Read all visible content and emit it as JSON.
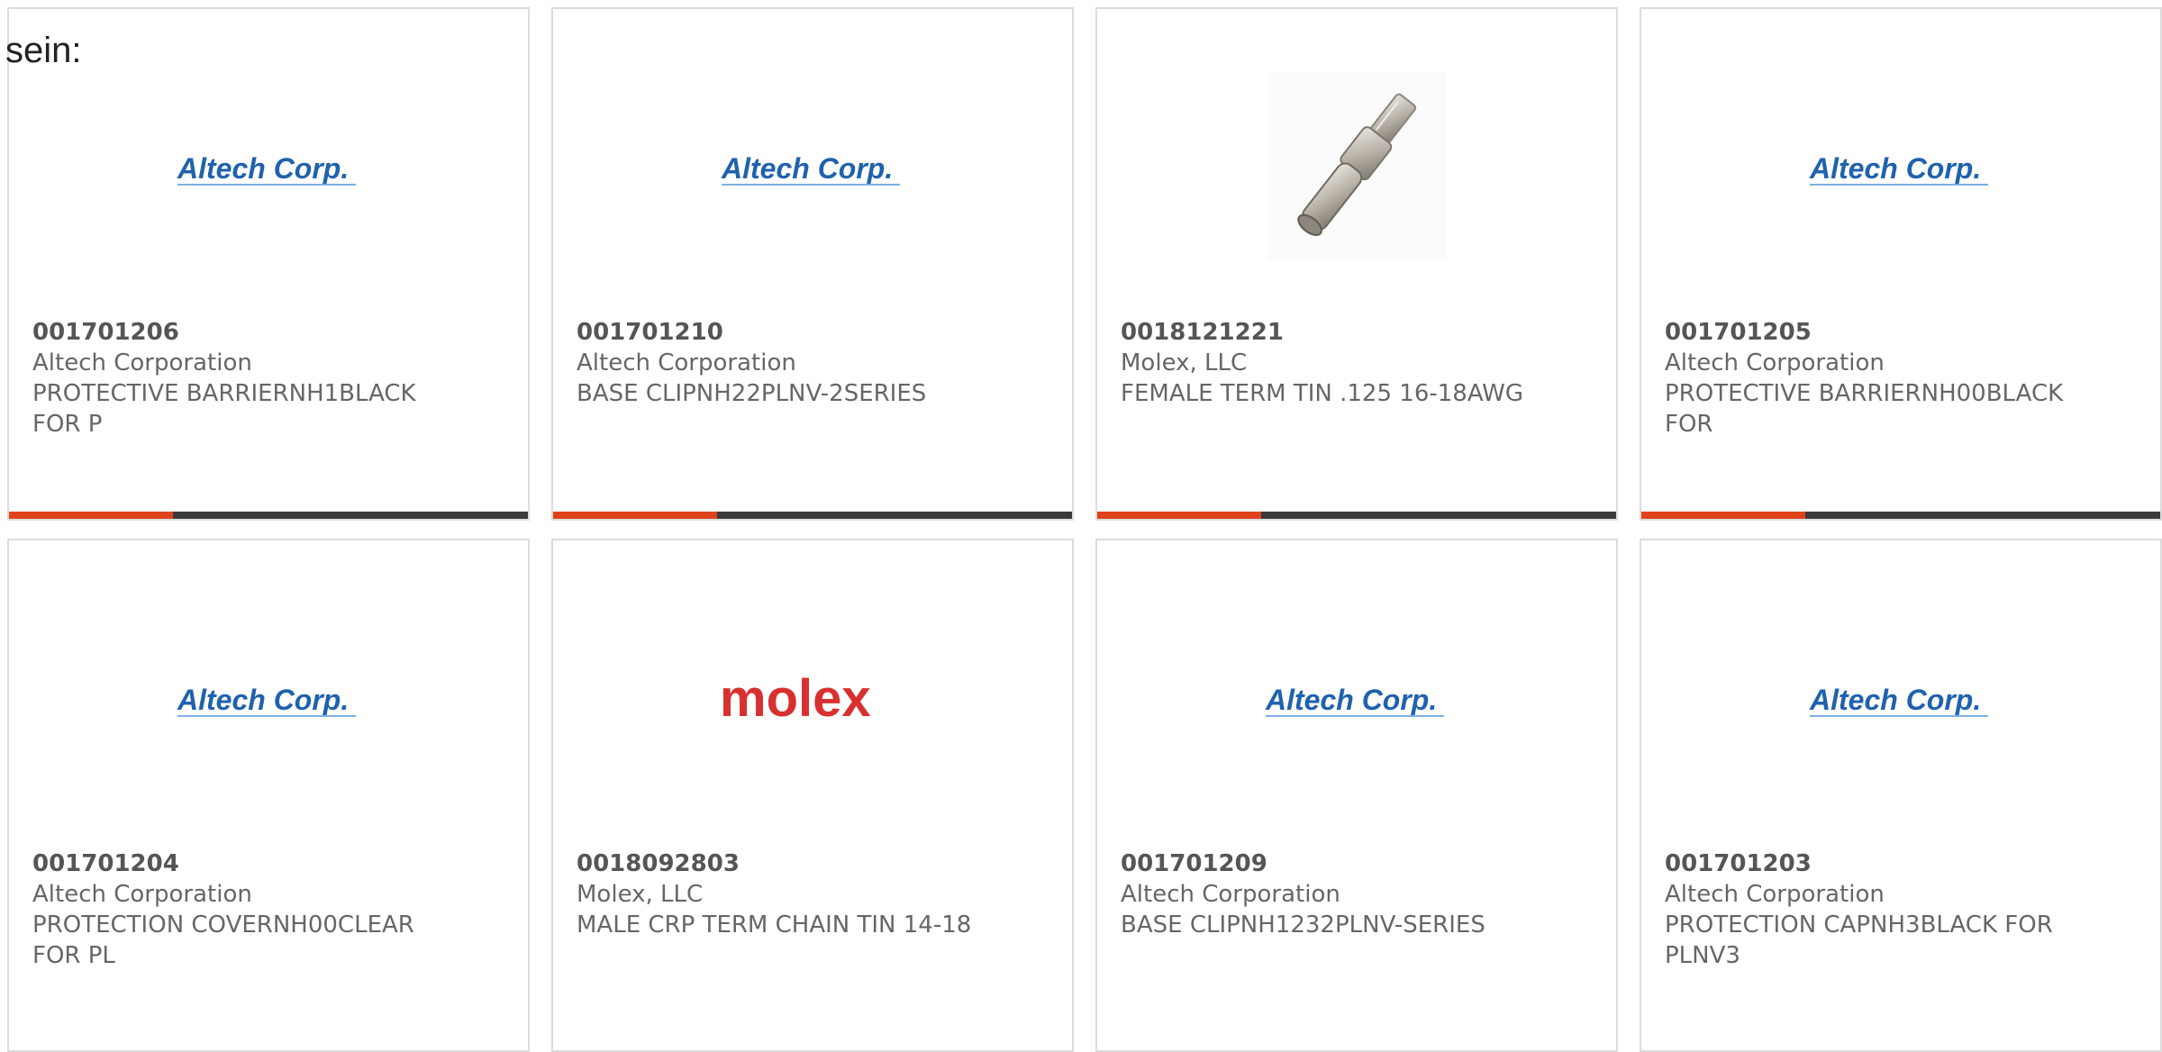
{
  "intro_text": "sein:",
  "colors": {
    "accent": "#e0431c",
    "bar": "#3b3b3b",
    "altech_blue": "#1f62ad",
    "molex_red": "#d8302f"
  },
  "products": [
    {
      "part_number": "001701206",
      "manufacturer": "Altech Corporation",
      "description": "PROTECTIVE BARRIERNH1BLACK FOR P",
      "image": "altech-logo",
      "logo_text": "Altech Corp."
    },
    {
      "part_number": "001701210",
      "manufacturer": "Altech Corporation",
      "description": "BASE CLIPNH22PLNV-2SERIES",
      "image": "altech-logo",
      "logo_text": "Altech Corp."
    },
    {
      "part_number": "0018121221",
      "manufacturer": "Molex, LLC",
      "description": "FEMALE TERM TIN .125 16-18AWG",
      "image": "crimp-terminal-photo",
      "logo_text": ""
    },
    {
      "part_number": "001701205",
      "manufacturer": "Altech Corporation",
      "description": "PROTECTIVE BARRIERNH00BLACK FOR",
      "image": "altech-logo",
      "logo_text": "Altech Corp."
    },
    {
      "part_number": "001701204",
      "manufacturer": "Altech Corporation",
      "description": "PROTECTION COVERNH00CLEAR FOR PL",
      "image": "altech-logo",
      "logo_text": "Altech Corp."
    },
    {
      "part_number": "0018092803",
      "manufacturer": "Molex, LLC",
      "description": "MALE CRP TERM CHAIN TIN 14-18",
      "image": "molex-logo",
      "logo_text": "molex"
    },
    {
      "part_number": "001701209",
      "manufacturer": "Altech Corporation",
      "description": "BASE CLIPNH1232PLNV-SERIES",
      "image": "altech-logo",
      "logo_text": "Altech Corp."
    },
    {
      "part_number": "001701203",
      "manufacturer": "Altech Corporation",
      "description": "PROTECTION CAPNH3BLACK FOR PLNV3",
      "image": "altech-logo",
      "logo_text": "Altech Corp."
    }
  ]
}
